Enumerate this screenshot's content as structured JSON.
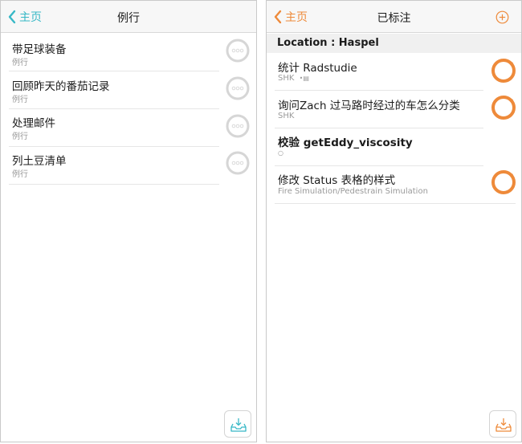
{
  "colors": {
    "accent_left": "#37b8c6",
    "accent_right": "#ee8a3a",
    "ring_grey": "#d6d6d6",
    "ring_orange": "#ee8a3a"
  },
  "left": {
    "back_label": "主页",
    "title": "例行",
    "items": [
      {
        "title": "带足球装备",
        "subtitle": "例行"
      },
      {
        "title": "回顾昨天的番茄记录",
        "subtitle": "例行"
      },
      {
        "title": "处理邮件",
        "subtitle": "例行"
      },
      {
        "title": "列土豆清单",
        "subtitle": "例行"
      }
    ],
    "bottom_icon": "inbox-download-icon"
  },
  "right": {
    "back_label": "主页",
    "title": "已标注",
    "add_icon": "plus-circle-icon",
    "section": "Location : Haspel",
    "items": [
      {
        "title": "统计 Radstudie",
        "subtitle": "SHK",
        "has_note_icon": true,
        "has_ring": true
      },
      {
        "title": "询问Zach 过马路时经过的车怎么分类",
        "subtitle": "SHK",
        "has_note_icon": false,
        "has_ring": true
      },
      {
        "title": "校验 getEddy_viscosity",
        "subtitle": "",
        "has_note_icon": false,
        "has_ring": false
      },
      {
        "title": "修改 Status 表格的样式",
        "subtitle": "Fire Simulation/Pedestrain Simulation",
        "has_note_icon": false,
        "has_ring": true
      }
    ],
    "bottom_icon": "inbox-download-icon"
  }
}
